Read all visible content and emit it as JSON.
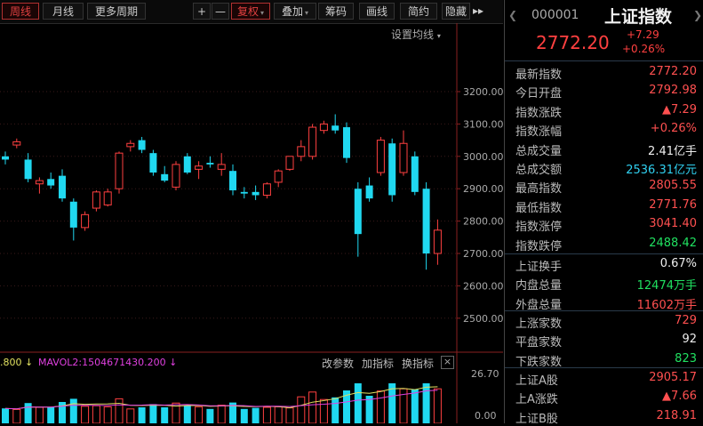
{
  "toolbar": {
    "tabs": [
      "周线",
      "月线",
      "更多周期"
    ],
    "zoom_in": "+",
    "zoom_out": "—",
    "buttons": [
      "复权",
      "叠加",
      "筹码",
      "画线",
      "简约",
      "隐藏"
    ],
    "expand": "▸▸"
  },
  "chart": {
    "settings_label": "设置均线",
    "price_ticks": [
      "3200.00",
      "3100.00",
      "3000.00",
      "2900.00",
      "2800.00",
      "2700.00",
      "2600.00",
      "2500.00"
    ],
    "volume_legend_left": ".800 ↓",
    "volume_legend_main": "MAVOL2:1504671430.200 ↓",
    "volume_tools": [
      "改参数",
      "加指标",
      "换指标"
    ],
    "close_icon": "×",
    "volume_ticks": [
      "26.70",
      "0.00"
    ]
  },
  "chart_data": {
    "type": "candlestick",
    "ylim": [
      2500,
      3230
    ],
    "candles": [
      {
        "o": 3000,
        "h": 3015,
        "l": 2975,
        "c": 2990
      },
      {
        "o": 3035,
        "h": 3055,
        "l": 3025,
        "c": 3045
      },
      {
        "o": 2990,
        "h": 3010,
        "l": 2920,
        "c": 2930
      },
      {
        "o": 2915,
        "h": 2935,
        "l": 2885,
        "c": 2925
      },
      {
        "o": 2930,
        "h": 2950,
        "l": 2900,
        "c": 2910
      },
      {
        "o": 2940,
        "h": 2960,
        "l": 2860,
        "c": 2870
      },
      {
        "o": 2860,
        "h": 2870,
        "l": 2740,
        "c": 2780
      },
      {
        "o": 2780,
        "h": 2830,
        "l": 2770,
        "c": 2820
      },
      {
        "o": 2840,
        "h": 2895,
        "l": 2830,
        "c": 2890
      },
      {
        "o": 2850,
        "h": 2900,
        "l": 2845,
        "c": 2890
      },
      {
        "o": 2900,
        "h": 3015,
        "l": 2885,
        "c": 3010
      },
      {
        "o": 3030,
        "h": 3050,
        "l": 3015,
        "c": 3040
      },
      {
        "o": 3050,
        "h": 3060,
        "l": 3010,
        "c": 3020
      },
      {
        "o": 3010,
        "h": 3020,
        "l": 2940,
        "c": 2950
      },
      {
        "o": 2945,
        "h": 2970,
        "l": 2920,
        "c": 2925
      },
      {
        "o": 2905,
        "h": 2985,
        "l": 2895,
        "c": 2975
      },
      {
        "o": 3000,
        "h": 3010,
        "l": 2945,
        "c": 2950
      },
      {
        "o": 2960,
        "h": 2985,
        "l": 2930,
        "c": 2970
      },
      {
        "o": 2980,
        "h": 3000,
        "l": 2965,
        "c": 2975
      },
      {
        "o": 2960,
        "h": 3010,
        "l": 2940,
        "c": 2975
      },
      {
        "o": 2955,
        "h": 2975,
        "l": 2880,
        "c": 2895
      },
      {
        "o": 2890,
        "h": 2905,
        "l": 2870,
        "c": 2885
      },
      {
        "o": 2890,
        "h": 2910,
        "l": 2865,
        "c": 2880
      },
      {
        "o": 2880,
        "h": 2920,
        "l": 2870,
        "c": 2915
      },
      {
        "o": 2920,
        "h": 2960,
        "l": 2905,
        "c": 2955
      },
      {
        "o": 2960,
        "h": 3000,
        "l": 2955,
        "c": 3000
      },
      {
        "o": 3000,
        "h": 3050,
        "l": 2985,
        "c": 3030
      },
      {
        "o": 3000,
        "h": 3100,
        "l": 2990,
        "c": 3090
      },
      {
        "o": 3080,
        "h": 3110,
        "l": 3070,
        "c": 3100
      },
      {
        "o": 3095,
        "h": 3130,
        "l": 3070,
        "c": 3080
      },
      {
        "o": 3090,
        "h": 3105,
        "l": 2980,
        "c": 2995
      },
      {
        "o": 2900,
        "h": 2920,
        "l": 2690,
        "c": 2760
      },
      {
        "o": 2910,
        "h": 2935,
        "l": 2860,
        "c": 2870
      },
      {
        "o": 2950,
        "h": 3060,
        "l": 2940,
        "c": 3050
      },
      {
        "o": 3040,
        "h": 3055,
        "l": 2860,
        "c": 2880
      },
      {
        "o": 2950,
        "h": 3080,
        "l": 2940,
        "c": 3040
      },
      {
        "o": 3000,
        "h": 3015,
        "l": 2880,
        "c": 2890
      },
      {
        "o": 2900,
        "h": 2920,
        "l": 2650,
        "c": 2700
      },
      {
        "o": 2700,
        "h": 2805,
        "l": 2665,
        "c": 2772
      }
    ]
  },
  "panel": {
    "code": "000001",
    "name": "上证指数",
    "price": "2772.20",
    "change": "+7.29",
    "change_pct": "+0.26%",
    "nav_prev": "❮",
    "nav_next": "❯",
    "rows1": [
      {
        "label": "最新指数",
        "value": "2772.20",
        "cls": "up"
      },
      {
        "label": "今日开盘",
        "value": "2792.98",
        "cls": "up"
      },
      {
        "label": "指数涨跌",
        "value": "▲7.29",
        "cls": "up"
      },
      {
        "label": "指数涨幅",
        "value": "+0.26%",
        "cls": "up"
      },
      {
        "label": "总成交量",
        "value": "2.41亿手",
        "cls": "wht"
      },
      {
        "label": "总成交额",
        "value": "2536.31亿元",
        "cls": "cyan"
      },
      {
        "label": "最高指数",
        "value": "2805.55",
        "cls": "up"
      },
      {
        "label": "最低指数",
        "value": "2771.76",
        "cls": "up"
      },
      {
        "label": "指数涨停",
        "value": "3041.40",
        "cls": "up"
      },
      {
        "label": "指数跌停",
        "value": "2488.42",
        "cls": "down"
      }
    ],
    "rows2": [
      {
        "label": "上证换手",
        "value": "0.67%",
        "cls": "wht"
      },
      {
        "label": "内盘总量",
        "value": "12474万手",
        "cls": "down"
      },
      {
        "label": "外盘总量",
        "value": "11602万手",
        "cls": "up"
      }
    ],
    "rows3": [
      {
        "label": "上涨家数",
        "value": "729",
        "cls": "up"
      },
      {
        "label": "平盘家数",
        "value": "92",
        "cls": "wht"
      },
      {
        "label": "下跌家数",
        "value": "823",
        "cls": "down"
      }
    ],
    "rows4": [
      {
        "label": "上证A股",
        "value": "2905.17",
        "cls": "up"
      },
      {
        "label": "上A涨跌",
        "value": "▲7.66",
        "cls": "up"
      },
      {
        "label": "上证B股",
        "value": "218.91",
        "cls": "up"
      }
    ]
  }
}
